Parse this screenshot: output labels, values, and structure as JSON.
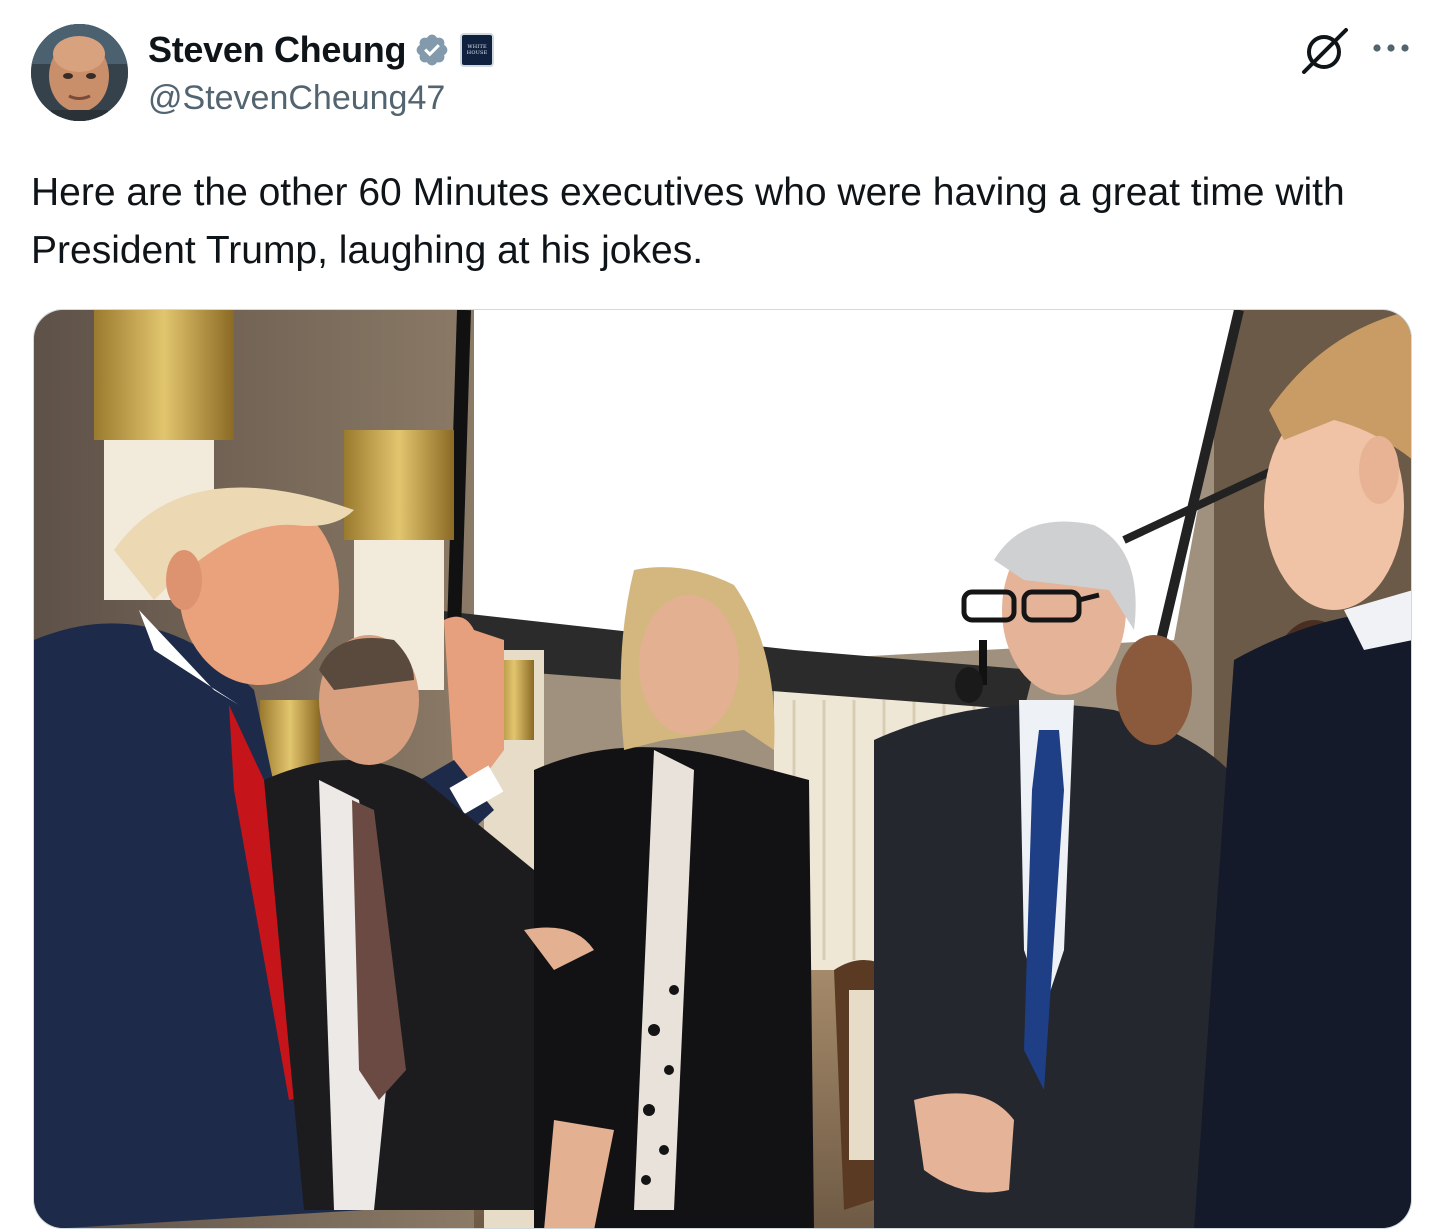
{
  "author": {
    "display_name": "Steven Cheung",
    "handle": "@StevenCheung47",
    "verified": true,
    "verified_badge_color": "#829aab",
    "affiliation_badge": "WHITE HOUSE"
  },
  "actions": {
    "grok_icon": "grok-icon",
    "more_icon": "more-icon"
  },
  "tweet": {
    "text": "Here are the other 60 Minutes executives who were having a great time with President Trump, laughing at his jokes."
  },
  "media": {
    "type": "photo"
  }
}
